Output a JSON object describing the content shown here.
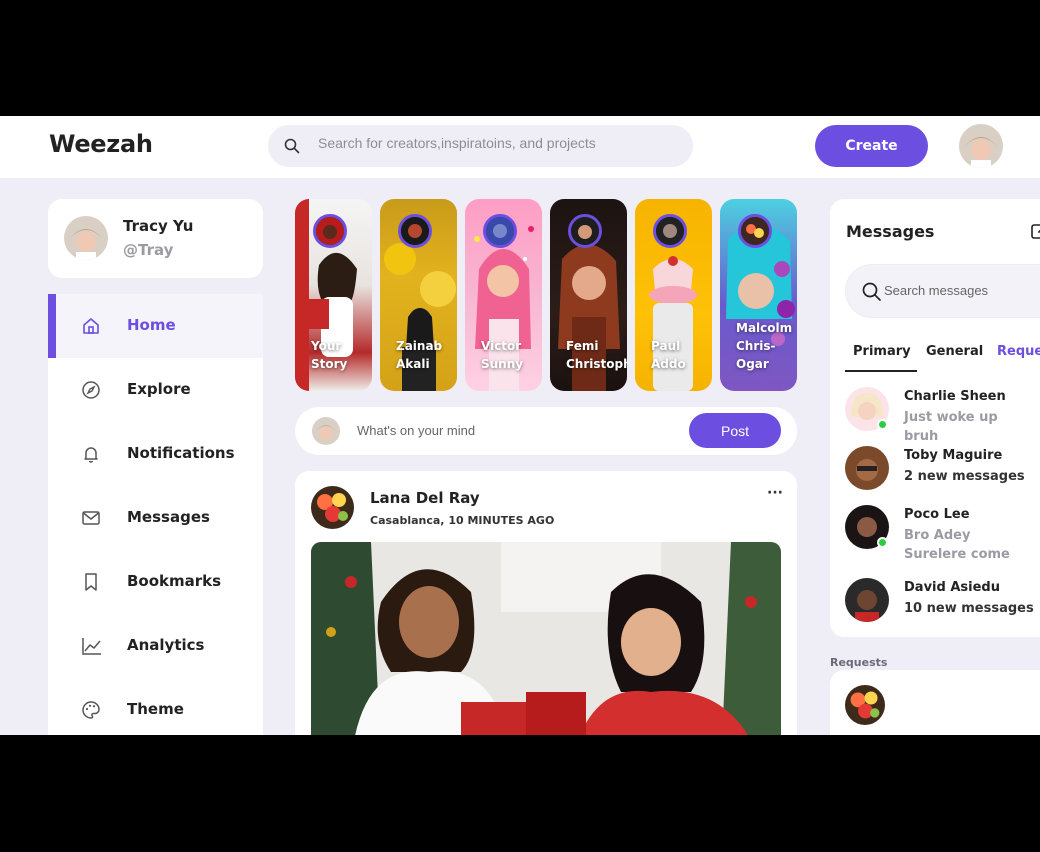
{
  "app": {
    "logo": "Weezah"
  },
  "header": {
    "search_placeholder": "Search for creators,inspiratoins, and projects",
    "create_label": "Create"
  },
  "profile": {
    "name": "Tracy Yu",
    "handle": "@Tray"
  },
  "sidebar": {
    "items": [
      {
        "label": "Home",
        "icon": "home-icon",
        "active": true
      },
      {
        "label": "Explore",
        "icon": "compass-icon",
        "active": false
      },
      {
        "label": "Notifications",
        "icon": "bell-icon",
        "active": false
      },
      {
        "label": "Messages",
        "icon": "envelope-icon",
        "active": false
      },
      {
        "label": "Bookmarks",
        "icon": "bookmark-icon",
        "active": false
      },
      {
        "label": "Analytics",
        "icon": "chart-icon",
        "active": false
      },
      {
        "label": "Theme",
        "icon": "palette-icon",
        "active": false
      }
    ]
  },
  "stories": [
    {
      "name": "Your\nStory"
    },
    {
      "name": "Zainab\nAkali"
    },
    {
      "name": "Victor\nSunny"
    },
    {
      "name": "Femi\nChristopher"
    },
    {
      "name": "Paul\nAddo"
    },
    {
      "name": "Malcolm\nChris-\nOgar"
    }
  ],
  "composer": {
    "placeholder": "What's on your mind",
    "post_label": "Post"
  },
  "feed": {
    "author": "Lana Del Ray",
    "meta": "Casablanca, 10 MINUTES AGO",
    "more": "···"
  },
  "messages": {
    "title": "Messages",
    "search_placeholder": "Search messages",
    "tabs": [
      "Primary",
      "General",
      "Requests"
    ],
    "items": [
      {
        "name": "Charlie Sheen",
        "text": "Just woke up bruh",
        "online": true,
        "muted": true
      },
      {
        "name": "Toby Maguire",
        "text": "2 new messages",
        "online": false,
        "muted": false
      },
      {
        "name": "Poco Lee",
        "text": "Bro Adey Surelere come",
        "online": true,
        "muted": true
      },
      {
        "name": "David Asiedu",
        "text": "10 new messages",
        "online": false,
        "muted": false
      }
    ]
  },
  "requests": {
    "label": "Requests"
  },
  "colors": {
    "accent": "#6c4ee0",
    "background": "#efeef7",
    "online": "#2ecc40"
  }
}
